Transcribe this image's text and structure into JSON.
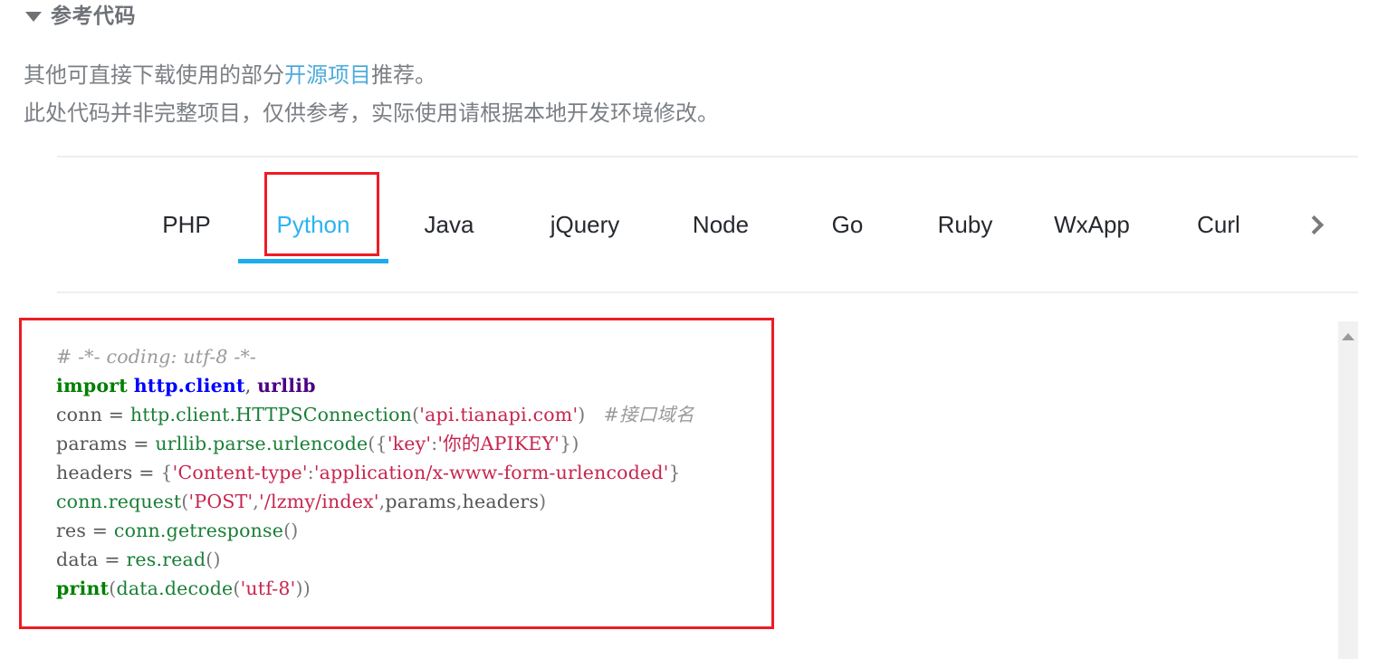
{
  "section": {
    "title": "参考代码",
    "collapse_icon": "triangle-down-icon"
  },
  "intro": {
    "line1_before": "其他可直接下载使用的部分",
    "line1_link": "开源项目",
    "line1_after": "推荐。",
    "line2": "此处代码并非完整项目，仅供参考，实际使用请根据本地开发环境修改。"
  },
  "tabs": {
    "items": [
      {
        "label": "PHP",
        "active": false
      },
      {
        "label": "Python",
        "active": true
      },
      {
        "label": "Java",
        "active": false
      },
      {
        "label": "jQuery",
        "active": false
      },
      {
        "label": "Node",
        "active": false
      },
      {
        "label": "Go",
        "active": false
      },
      {
        "label": "Ruby",
        "active": false
      },
      {
        "label": "WxApp",
        "active": false
      },
      {
        "label": "Curl",
        "active": false
      }
    ],
    "next_icon": "chevron-right-icon",
    "active_index": 1
  },
  "code": {
    "language": "Python",
    "lines": [
      "# -*- coding: utf-8 -*-",
      "import http.client, urllib",
      "conn = http.client.HTTPSConnection('api.tianapi.com')   #接口域名",
      "params = urllib.parse.urlencode({'key':'你的APIKEY'})",
      "headers = {'Content-type':'application/x-www-form-urlencoded'}",
      "conn.request('POST','/lzmy/index',params,headers)",
      "res = conn.getresponse()",
      "data = res.read()",
      "print(data.decode('utf-8'))"
    ],
    "api_host": "api.tianapi.com",
    "api_path": "/lzmy/index",
    "api_key_placeholder": "你的APIKEY",
    "content_type": "application/x-www-form-urlencoded",
    "http_method": "POST",
    "inline_comment": "#接口域名",
    "encoding_comment": "# -*- coding: utf-8 -*-"
  },
  "scrollbar": {
    "up_icon": "triangle-up-icon"
  },
  "annotations": [
    {
      "name": "python-tab-highlight",
      "color": "#ed1c24"
    },
    {
      "name": "code-block-highlight",
      "color": "#ed1c24"
    }
  ],
  "colors": {
    "accent_blue": "#1eabf0",
    "link_blue": "#4eabdb",
    "annotation_red": "#ed1c24",
    "title_gray": "#6e7277",
    "body_gray": "#7b7f84",
    "code_string": "#c7254e",
    "code_keyword": "#008000",
    "code_module": "#0000ff",
    "code_comment": "#9a9a9a"
  }
}
